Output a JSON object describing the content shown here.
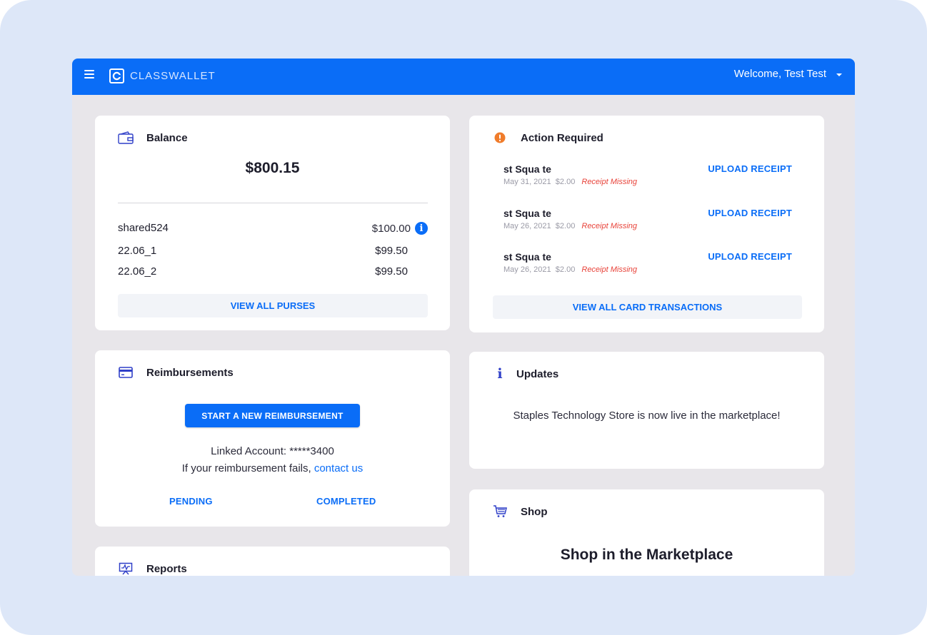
{
  "header": {
    "logo_text": "CLASSWALLET",
    "welcome": "Welcome, Test Test"
  },
  "balance": {
    "title": "Balance",
    "amount": "$800.15",
    "purses": [
      {
        "name": "shared524",
        "value": "$100.00",
        "info": true
      },
      {
        "name": "22.06_1",
        "value": "$99.50"
      },
      {
        "name": "22.06_2",
        "value": "$99.50"
      }
    ],
    "view_all_label": "VIEW ALL PURSES"
  },
  "action_required": {
    "title": "Action Required",
    "transactions": [
      {
        "name": "st Squa te",
        "date": "May 31, 2021",
        "amount": "$2.00",
        "status": "Receipt Missing",
        "action": "UPLOAD RECEIPT"
      },
      {
        "name": "st Squa te",
        "date": "May 26, 2021",
        "amount": "$2.00",
        "status": "Receipt Missing",
        "action": "UPLOAD RECEIPT"
      },
      {
        "name": "st Squa te",
        "date": "May 26, 2021",
        "amount": "$2.00",
        "status": "Receipt Missing",
        "action": "UPLOAD RECEIPT"
      }
    ],
    "view_all_label": "VIEW ALL CARD TRANSACTIONS"
  },
  "reimbursements": {
    "title": "Reimbursements",
    "start_label": "START A NEW REIMBURSEMENT",
    "linked_account": "Linked Account: *****3400",
    "fail_text": "If your reimbursement fails,",
    "contact_label": "contact us",
    "pending_label": "PENDING",
    "completed_label": "COMPLETED"
  },
  "updates": {
    "title": "Updates",
    "message": "Staples Technology Store is now live in the marketplace!"
  },
  "shop": {
    "title": "Shop",
    "headline": "Shop in the Marketplace"
  },
  "reports": {
    "title": "Reports"
  },
  "colors": {
    "accent": "#0a6df7",
    "warning": "#f07c2b",
    "missing": "#e8433a"
  }
}
